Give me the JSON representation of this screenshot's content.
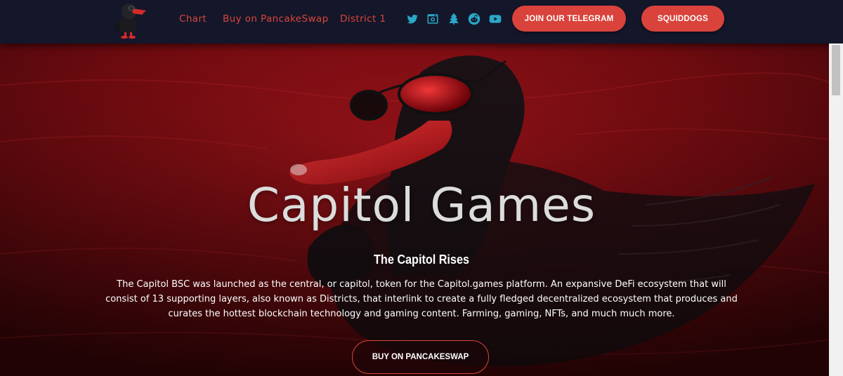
{
  "header": {
    "nav": [
      {
        "label": "Chart"
      },
      {
        "label": "Buy on PancakeSwap"
      },
      {
        "label": "District 1"
      }
    ],
    "social_icons": [
      "twitter-icon",
      "camera-icon",
      "tree-icon",
      "reddit-icon",
      "youtube-icon"
    ],
    "telegram_button": "JOIN OUR TELEGRAM",
    "squiddogs_button": "SQUIDDOGS"
  },
  "hero": {
    "title": "Capitol Games",
    "subtitle": "The Capitol Rises",
    "description": "The Capitol BSC was launched as the central, or capitol, token for the Capitol.games platform. An expansive DeFi ecosystem that will consist of 13 supporting layers, also known as Districts, that interlink to create a fully fledged decentralized ecosystem that produces and curates the hottest blockchain technology and gaming content. Farming, gaming, NFTs, and much much more.",
    "cta_button": "BUY ON PANCAKESWAP"
  },
  "colors": {
    "header_bg": "#14162a",
    "accent": "#d9433b",
    "social_icon": "#2aa8c6",
    "hero_red": "#8a0d12"
  }
}
